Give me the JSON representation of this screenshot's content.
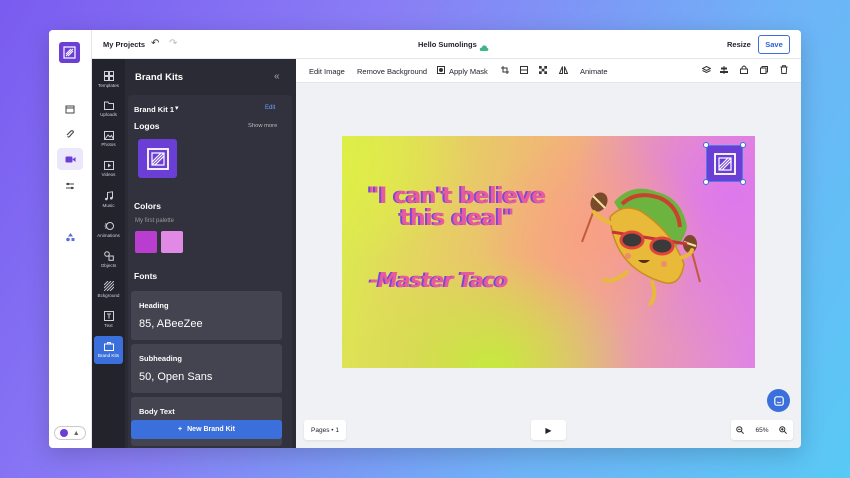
{
  "header": {
    "my_projects": "My Projects",
    "document_title": "Hello Sumolings",
    "resize_label": "Resize",
    "save_label": "Save"
  },
  "tools": [
    {
      "label": "Templates",
      "icon": "grid-icon"
    },
    {
      "label": "Uploads",
      "icon": "folder-icon"
    },
    {
      "label": "Photos",
      "icon": "image-icon"
    },
    {
      "label": "Videos",
      "icon": "video-icon"
    },
    {
      "label": "Music",
      "icon": "music-icon"
    },
    {
      "label": "Animations",
      "icon": "animation-icon"
    },
    {
      "label": "Objects",
      "icon": "shapes-icon"
    },
    {
      "label": "Bckground",
      "icon": "pattern-icon"
    },
    {
      "label": "Text",
      "icon": "text-icon"
    },
    {
      "label": "Brand Kits",
      "icon": "briefcase-icon"
    }
  ],
  "brand_panel": {
    "title": "Brand Kits",
    "kit_name": "Brand Kit 1",
    "edit_label": "Edit",
    "logos_heading": "Logos",
    "show_more": "Show more",
    "colors_heading": "Colors",
    "palette_name": "My first palette",
    "swatches": [
      "#b93ed0",
      "#e08ae6"
    ],
    "fonts_heading": "Fonts",
    "fonts": [
      {
        "label": "Heading",
        "value": "85, ABeeZee"
      },
      {
        "label": "Subheading",
        "value": "50, Open Sans"
      },
      {
        "label": "Body Text",
        "value": ""
      }
    ],
    "new_kit_label": "New Brand Kit"
  },
  "canvas_toolbar": {
    "edit_image": "Edit Image",
    "remove_background": "Remove Background",
    "apply_mask": "Apply Mask",
    "animate": "Animate"
  },
  "canvas": {
    "quote": "\"I can't believe this deal\"",
    "author": "-Master Taco"
  },
  "footer": {
    "pages_label": "Pages • 1",
    "zoom_level": "65%"
  },
  "colors": {
    "brand_purple": "#6b3fd6",
    "accent_blue": "#3b6fdc",
    "text_pink": "#e85a9e"
  }
}
